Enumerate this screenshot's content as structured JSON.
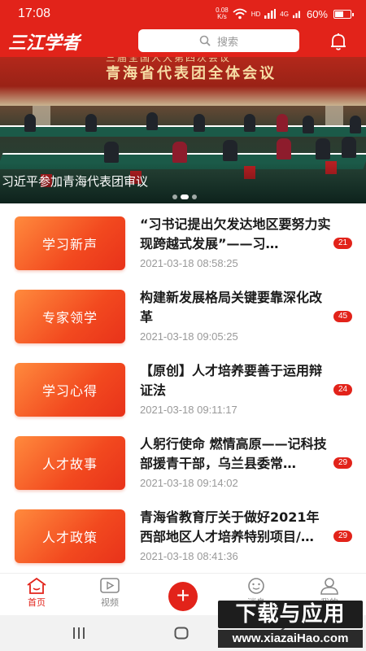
{
  "status_bar": {
    "time": "17:08",
    "net_speed_value": "0.08",
    "net_speed_unit": "K/s",
    "network": "HD",
    "signal": "4G",
    "battery": "60%",
    "battery_level": 0.6
  },
  "header": {
    "logo_text": "三江学者",
    "search_placeholder": "搜索"
  },
  "banner": {
    "wall_text": "青海省代表团全体会议",
    "wall_text_top": "三届全国人大第四次会议",
    "caption": "习近平参加青海代表团审议",
    "slide_count": 3,
    "active_slide": 2
  },
  "articles": [
    {
      "category": "学习新声",
      "title": "“习书记提出欠发达地区要努力实现跨越式发展”——习…",
      "date": "2021-03-18 08:58:25",
      "count": "21"
    },
    {
      "category": "专家领学",
      "title": "构建新发展格局关键要靠深化改革",
      "date": "2021-03-18 09:05:25",
      "count": "45"
    },
    {
      "category": "学习心得",
      "title": "【原创】人才培养要善于运用辩证法",
      "date": "2021-03-18 09:11:17",
      "count": "24"
    },
    {
      "category": "人才故事",
      "title": "人躬行使命 燃情高原——记科技部援青干部，乌兰县委常…",
      "date": "2021-03-18 09:14:02",
      "count": "29"
    },
    {
      "category": "人才政策",
      "title": "青海省教育厅关于做好2021年西部地区人才培养特别项目/…",
      "date": "2021-03-18 08:41:36",
      "count": "29"
    }
  ],
  "bottom_nav": {
    "home": "首页",
    "video": "视频",
    "add": "+",
    "message": "消息",
    "profile": "我的"
  },
  "watermark": {
    "main": "下载与应用",
    "sub": "www.xiazaiHao.com"
  },
  "colors": {
    "brand_red": "#e2231a",
    "button_orange": "#f2491f"
  }
}
